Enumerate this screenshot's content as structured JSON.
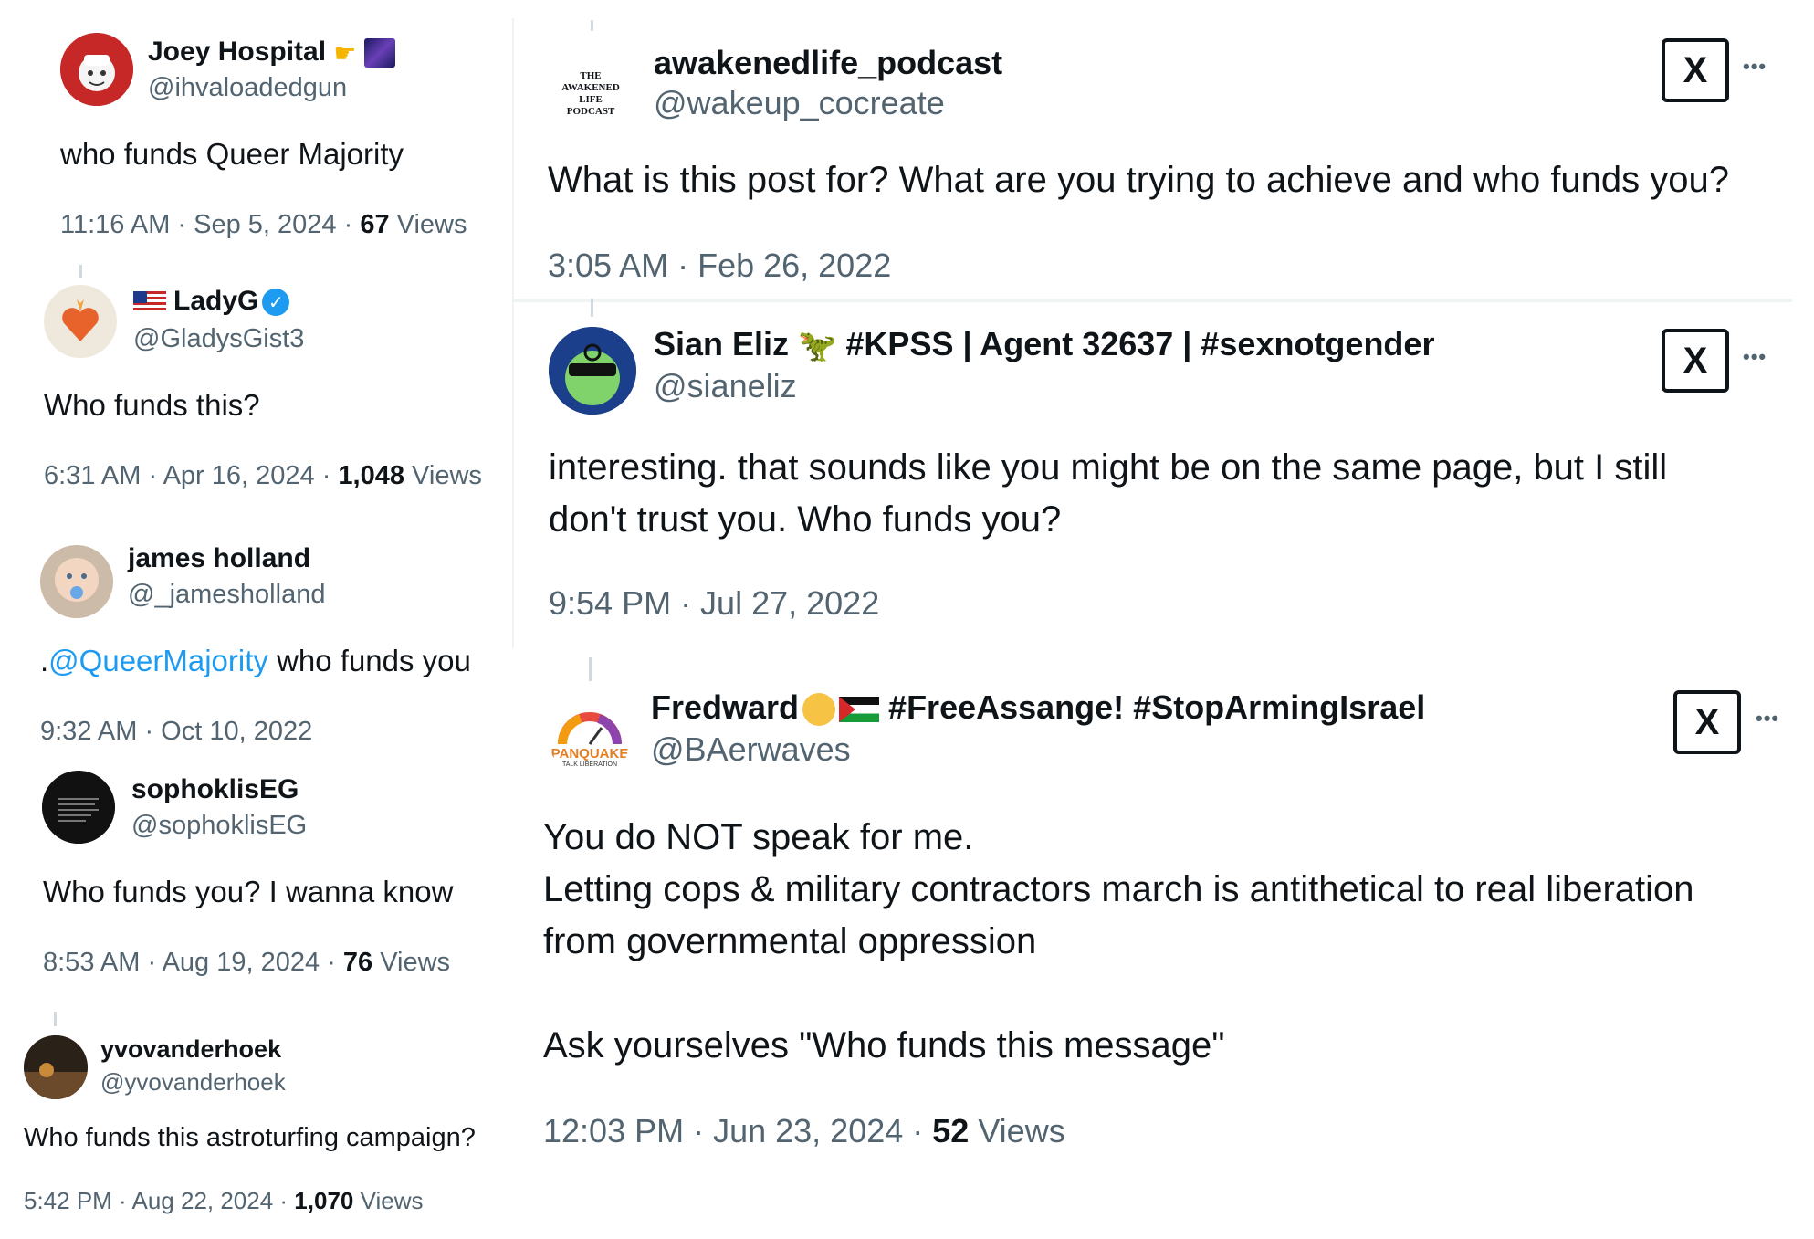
{
  "left_column": [
    {
      "name": "Joey Hospital",
      "handle": "@ihvaloadedgun",
      "text": "who funds Queer Majority",
      "time": "11:16 AM · Sep 5, 2024 · ",
      "views_count": "67",
      "views_label": " Views"
    },
    {
      "name": "LadyG",
      "handle": "@GladysGist3",
      "text": "Who funds this?",
      "time": "6:31 AM · Apr 16, 2024 · ",
      "views_count": "1,048",
      "views_label": " Views"
    },
    {
      "name": "james holland",
      "handle": "@_jamesholland",
      "text_prefix": ".",
      "mention": "@QueerMajority",
      "text_suffix": " who funds you",
      "time": "9:32 AM · Oct 10, 2022"
    },
    {
      "name": "sophoklisEG",
      "handle": "@sophoklisEG",
      "text": "Who funds you? I wanna know",
      "time": "8:53 AM · Aug 19, 2024 · ",
      "views_count": "76",
      "views_label": " Views"
    },
    {
      "name": "yvovanderhoek",
      "handle": "@yvovanderhoek",
      "text": "Who funds this astroturfing campaign?",
      "time": "5:42 PM · Aug 22, 2024 · ",
      "views_count": "1,070",
      "views_label": " Views"
    }
  ],
  "right_column": [
    {
      "name": "awakenedlife_podcast",
      "handle": "@wakeup_cocreate",
      "avatar_text": "THE AWAKENED LIFE PODCAST",
      "text": "What is this post for? What are you trying to achieve and who funds you?",
      "time": "3:05 AM · Feb 26, 2022"
    },
    {
      "name": "Sian Eliz",
      "name_suffix": " #KPSS | Agent 32637 | #sexnotgender",
      "handle": "@sianeliz",
      "text_line1": "interesting. that sounds like you might be on the same page, but I still",
      "text_line2": "don't trust you. Who funds you?",
      "time": "9:54 PM · Jul 27, 2022"
    },
    {
      "name": "Fredward",
      "name_suffix": " #FreeAssange! #StopArmingIsrael",
      "handle": "@BAerwaves",
      "avatar_text": "PANQUAKE",
      "avatar_subtext": "TALK LIBERATION",
      "text_line1": "You do NOT speak for me.",
      "text_line2": "Letting cops & military contractors march is antithetical to real liberation",
      "text_line3": "from governmental oppression",
      "text_line4": "Ask yourselves \"Who funds this message\"",
      "time": "12:03 PM · Jun 23, 2024 · ",
      "views_count": "52",
      "views_label": " Views"
    }
  ],
  "icons": {
    "x_logo": "X",
    "more": "•••"
  },
  "colors": {
    "link": "#1d9bf0",
    "secondary_text": "#536471",
    "primary_text": "#0f1419"
  }
}
